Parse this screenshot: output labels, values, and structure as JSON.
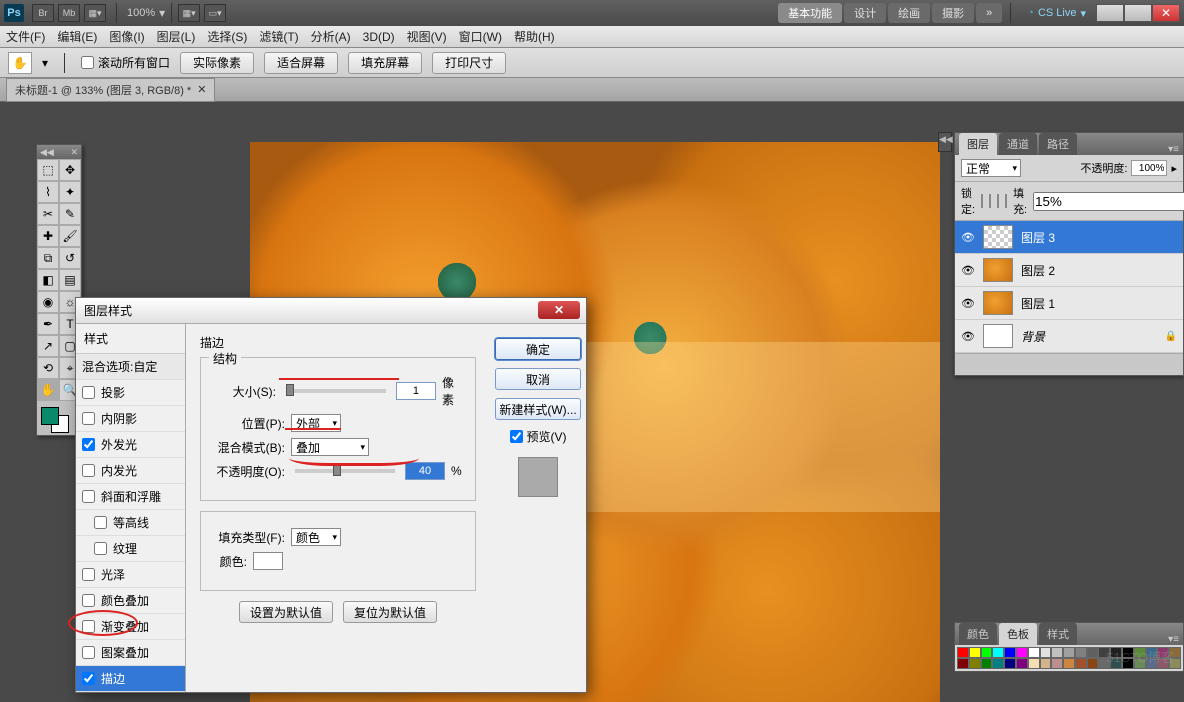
{
  "title_bar": {
    "logo": "Ps",
    "br": "Br",
    "mb": "Mb",
    "zoom": "100%",
    "modes": {
      "basic": "基本功能",
      "design": "设计",
      "paint": "绘画",
      "photo": "摄影",
      "more": "»"
    },
    "cs_live": "CS Live"
  },
  "menu": {
    "file": "文件(F)",
    "edit": "编辑(E)",
    "image": "图像(I)",
    "layer": "图层(L)",
    "select": "选择(S)",
    "filter": "滤镜(T)",
    "analysis": "分析(A)",
    "threeD": "3D(D)",
    "view": "视图(V)",
    "window": "窗口(W)",
    "help": "帮助(H)"
  },
  "options": {
    "scroll_all": "滚动所有窗口",
    "actual_px": "实际像素",
    "fit_screen": "适合屏幕",
    "fill_screen": "填充屏幕",
    "print_size": "打印尺寸"
  },
  "doc_tab": {
    "title": "未标题-1 @ 133% (图层 3, RGB/8) *"
  },
  "dialog": {
    "title": "图层样式",
    "left_header": "样式",
    "blend_options": "混合选项:自定",
    "styles": {
      "drop_shadow": "投影",
      "inner_shadow": "内阴影",
      "outer_glow": "外发光",
      "inner_glow": "内发光",
      "bevel": "斜面和浮雕",
      "contour": "等高线",
      "texture": "纹理",
      "satin": "光泽",
      "color_overlay": "颜色叠加",
      "gradient_overlay": "渐变叠加",
      "pattern_overlay": "图案叠加",
      "stroke": "描边"
    },
    "section": {
      "stroke_title": "描边",
      "structure": "结构",
      "size_label": "大小(S):",
      "size_value": "1",
      "size_unit": "像素",
      "position_label": "位置(P):",
      "position_value": "外部",
      "blend_label": "混合模式(B):",
      "blend_value": "叠加",
      "opacity_label": "不透明度(O):",
      "opacity_value": "40",
      "opacity_unit": "%",
      "fill_type_label": "填充类型(F):",
      "fill_type_value": "颜色",
      "color_label": "颜色:"
    },
    "buttons": {
      "ok": "确定",
      "cancel": "取消",
      "new_style": "新建样式(W)...",
      "preview": "预览(V)",
      "set_default": "设置为默认值",
      "reset_default": "复位为默认值"
    }
  },
  "layers_panel": {
    "tabs": {
      "layers": "图层",
      "channels": "通道",
      "paths": "路径"
    },
    "blend": "正常",
    "opacity_label": "不透明度:",
    "opacity": "100%",
    "lock_label": "锁定:",
    "fill_label": "填充:",
    "fill": "15%",
    "rows": {
      "l3": "图层 3",
      "l2": "图层 2",
      "l1": "图层 1",
      "bg": "背景"
    }
  },
  "swatches_panel": {
    "tabs": {
      "color": "颜色",
      "swatches": "色板",
      "styles": "样式"
    }
  },
  "swatch_colors": [
    "#ff0000",
    "#ffff00",
    "#00ff00",
    "#00ffff",
    "#0000ff",
    "#ff00ff",
    "#ffffff",
    "#e0e0e0",
    "#c0c0c0",
    "#a0a0a0",
    "#808080",
    "#606060",
    "#404040",
    "#202020",
    "#000000",
    "#5a8a3a",
    "#3a6a8a",
    "#8a3a6a",
    "#8a6a3a",
    "#800000",
    "#808000",
    "#008000",
    "#008080",
    "#000080",
    "#800080",
    "#f5deb3",
    "#d2b48c",
    "#bc8f8f",
    "#cd853f",
    "#a0522d",
    "#8b4513",
    "#696969",
    "#2f4f4f",
    "#000000",
    "#6a8a5a",
    "#5a6a8a",
    "#8a5a6a",
    "#8a8a5a"
  ],
  "watermark": "51CTO博客"
}
